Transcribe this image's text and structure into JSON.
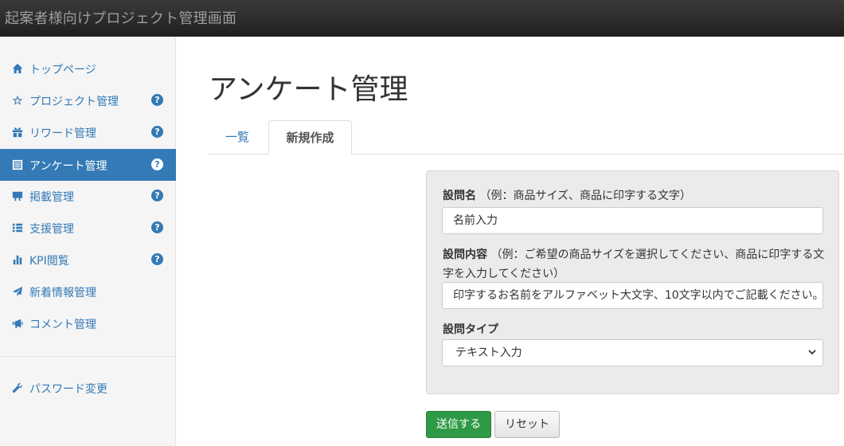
{
  "header": {
    "title": "起案者様向けプロジェクト管理画面"
  },
  "sidebar": {
    "items": [
      {
        "label": "トップページ",
        "icon": "home-icon",
        "help": false,
        "active": false
      },
      {
        "label": "プロジェクト管理",
        "icon": "star-outline-icon",
        "help": true,
        "active": false
      },
      {
        "label": "リワード管理",
        "icon": "gift-icon",
        "help": true,
        "active": false
      },
      {
        "label": "アンケート管理",
        "icon": "list-alt-icon",
        "help": true,
        "active": true
      },
      {
        "label": "掲載管理",
        "icon": "blackboard-icon",
        "help": true,
        "active": false
      },
      {
        "label": "支援管理",
        "icon": "list-icon",
        "help": true,
        "active": false
      },
      {
        "label": "KPI閲覧",
        "icon": "bar-chart-icon",
        "help": true,
        "active": false
      },
      {
        "label": "新着情報管理",
        "icon": "send-icon",
        "help": false,
        "active": false
      },
      {
        "label": "コメント管理",
        "icon": "bullhorn-icon",
        "help": false,
        "active": false
      }
    ],
    "footer_items": [
      {
        "label": "パスワード変更",
        "icon": "wrench-icon"
      }
    ],
    "help_glyph": "?"
  },
  "main": {
    "title": "アンケート管理",
    "tabs": [
      {
        "label": "一覧",
        "active": false
      },
      {
        "label": "新規作成",
        "active": true
      }
    ]
  },
  "form": {
    "question_name": {
      "label": "設問名",
      "hint": "（例：商品サイズ、商品に印字する文字）",
      "value": "名前入力"
    },
    "question_content": {
      "label": "設問内容",
      "hint_line1": "（例：ご希望の商品サイズを選択してください、商品に印字する文",
      "hint_line2": "字を入力してください）",
      "value": "印字するお名前をアルファベット大文字、10文字以内でご記載ください。"
    },
    "question_type": {
      "label": "設問タイプ",
      "selected": "テキスト入力"
    },
    "submit_label": "送信する",
    "reset_label": "リセット"
  },
  "colors": {
    "accent": "#337ab7",
    "submit": "#2f9a45",
    "topbar": "#222222"
  }
}
